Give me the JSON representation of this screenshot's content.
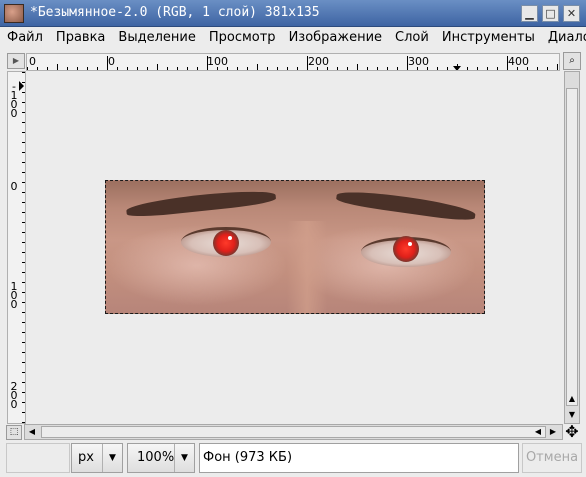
{
  "window": {
    "title": "*Безымянное-2.0 (RGB, 1 слой) 381x135",
    "minimize_glyph": "▁",
    "maximize_glyph": "□",
    "close_glyph": "✕"
  },
  "menu": {
    "items": [
      "Файл",
      "Правка",
      "Выделение",
      "Просмотр",
      "Изображение",
      "Слой",
      "Инструменты",
      "Диало"
    ]
  },
  "rulers": {
    "horizontal_labels": [
      "0",
      "0",
      "100",
      "200",
      "300",
      "400"
    ],
    "vertical_labels": [
      "-100",
      "0",
      "100",
      "200"
    ]
  },
  "canvas": {
    "layer_description": "photo of eyes with red-eye"
  },
  "status": {
    "unit": "px",
    "zoom": "100%",
    "layer_info": "Фон (973 КБ)",
    "cancel_label": "Отмена"
  },
  "icons": {
    "corner_menu": "triangle-right",
    "navigate": "zoom-navigate",
    "quick_mask": "quick-mask",
    "move": "four-arrows"
  }
}
